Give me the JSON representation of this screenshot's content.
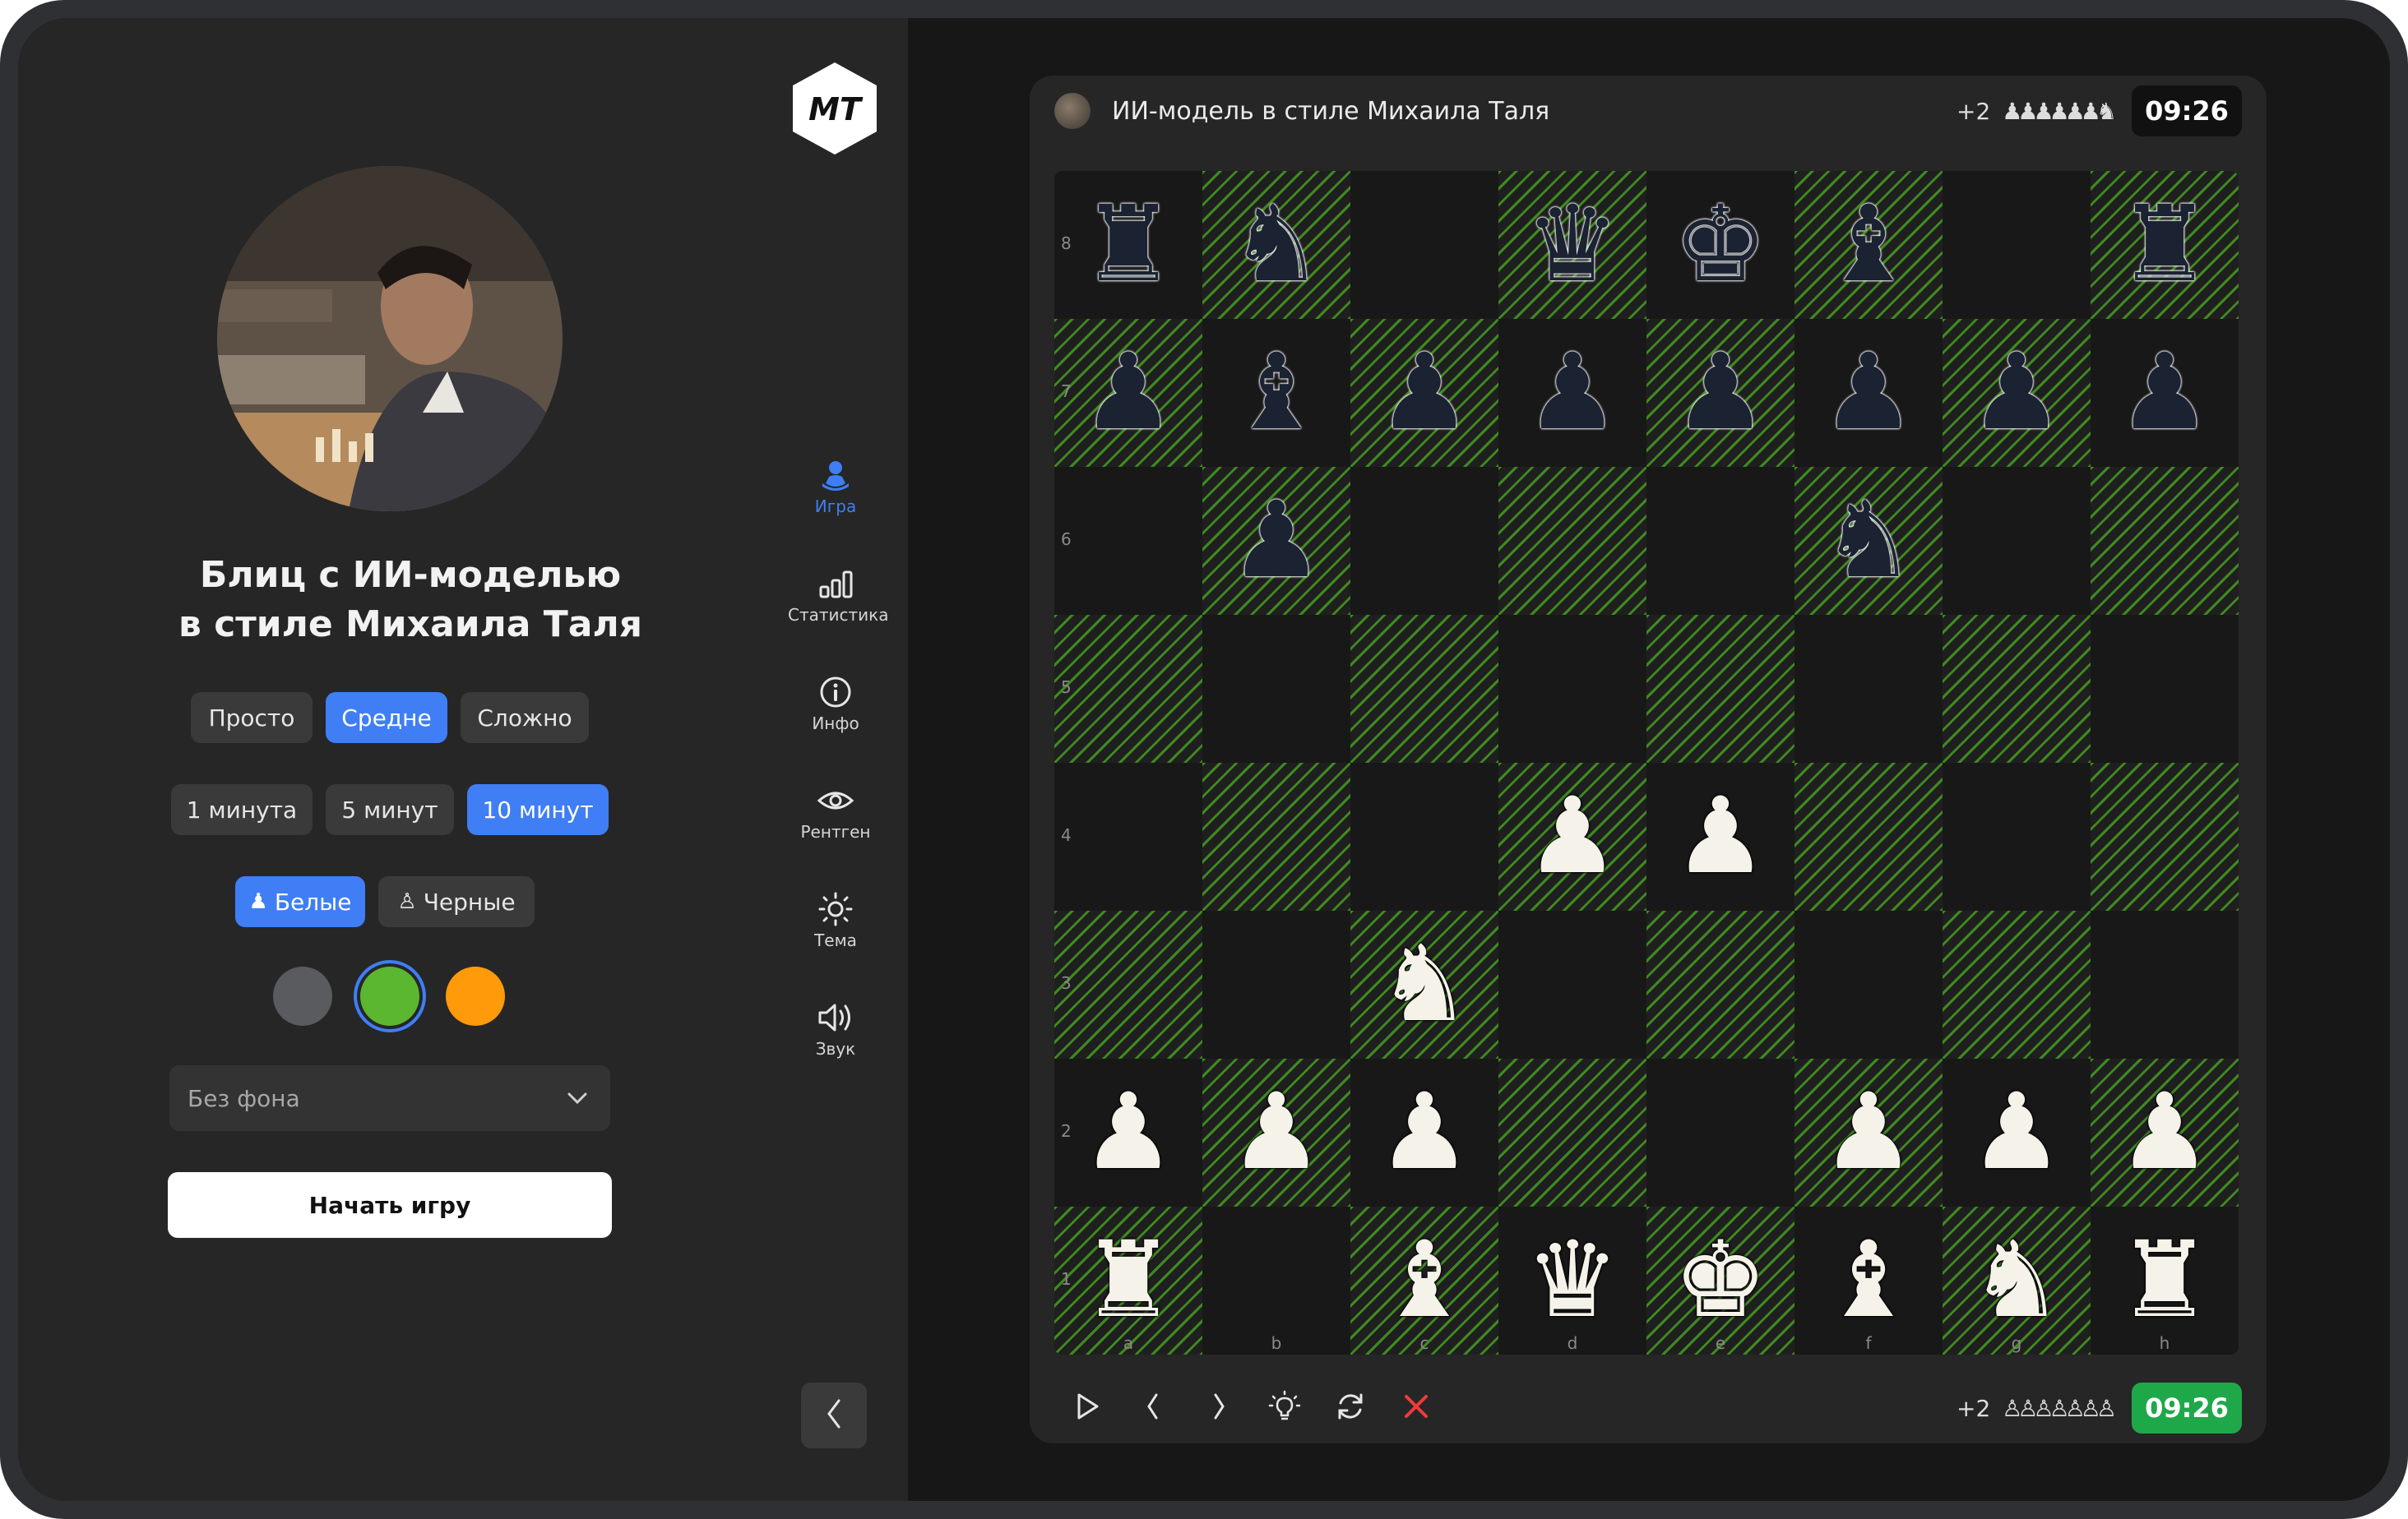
{
  "setup": {
    "title_line1": "Блиц с ИИ-моделью",
    "title_line2": "в стиле Михаила Таля",
    "difficulty": [
      {
        "label": "Просто",
        "active": false
      },
      {
        "label": "Средне",
        "active": true
      },
      {
        "label": "Сложно",
        "active": false
      }
    ],
    "time": [
      {
        "label": "1 минута",
        "active": false
      },
      {
        "label": "5 минут",
        "active": false
      },
      {
        "label": "10 минут",
        "active": true
      }
    ],
    "side": [
      {
        "label": "Белые",
        "icon": "pawn-icon",
        "active": true
      },
      {
        "label": "Черные",
        "icon": "pawn-outline-icon",
        "active": false
      }
    ],
    "colors": [
      "#5a5b5e",
      "#5bb630",
      "#ff9a0a"
    ],
    "selected_color": "#5bb630",
    "background_select": "Без фона",
    "start_button": "Начать игру"
  },
  "nav": {
    "logo": "МТ",
    "items": [
      {
        "label": "Игра",
        "icon": "pawn-icon",
        "active": true
      },
      {
        "label": "Статистика",
        "icon": "chart-icon",
        "active": false
      },
      {
        "label": "Инфо",
        "icon": "info-icon",
        "active": false
      },
      {
        "label": "Рентген",
        "icon": "eye-icon",
        "active": false
      },
      {
        "label": "Тема",
        "icon": "sun-icon",
        "active": false
      },
      {
        "label": "Звук",
        "icon": "speaker-icon",
        "active": false
      }
    ],
    "collapse_icon": "chevron-left-icon"
  },
  "game": {
    "opponent_name": "ИИ-модель в стиле Михаила Таля",
    "opponent_advantage": "+2",
    "opponent_captured": "♟♟♟♟♟♟♞",
    "opponent_timer": "09:26",
    "player_advantage": "+2",
    "player_captured": "♙♙♙♙♙♙♙",
    "player_timer": "09:26",
    "accent_color": "#3f7ef5",
    "controls": [
      "play-icon",
      "prev-move-icon",
      "next-move-icon",
      "hint-bulb-icon",
      "rotate-icon",
      "resign-icon"
    ],
    "ranks": [
      "8",
      "7",
      "6",
      "5",
      "4",
      "3",
      "2",
      "1"
    ],
    "files": [
      "a",
      "b",
      "c",
      "d",
      "e",
      "f",
      "g",
      "h"
    ],
    "board": [
      [
        "r",
        "n",
        "",
        "q",
        "k",
        "b",
        "",
        "r"
      ],
      [
        "p",
        "b",
        "p",
        "p",
        "p",
        "p",
        "p",
        "p"
      ],
      [
        "",
        "p",
        "",
        "",
        "",
        "n",
        "",
        ""
      ],
      [
        "",
        "",
        "",
        "",
        "",
        "",
        "",
        ""
      ],
      [
        "",
        "",
        "",
        "P",
        "P",
        "",
        "",
        ""
      ],
      [
        "",
        "",
        "N",
        "",
        "",
        "",
        "",
        ""
      ],
      [
        "P",
        "P",
        "P",
        "",
        "",
        "P",
        "P",
        "P"
      ],
      [
        "R",
        "",
        "B",
        "Q",
        "K",
        "B",
        "N",
        "R"
      ]
    ]
  }
}
